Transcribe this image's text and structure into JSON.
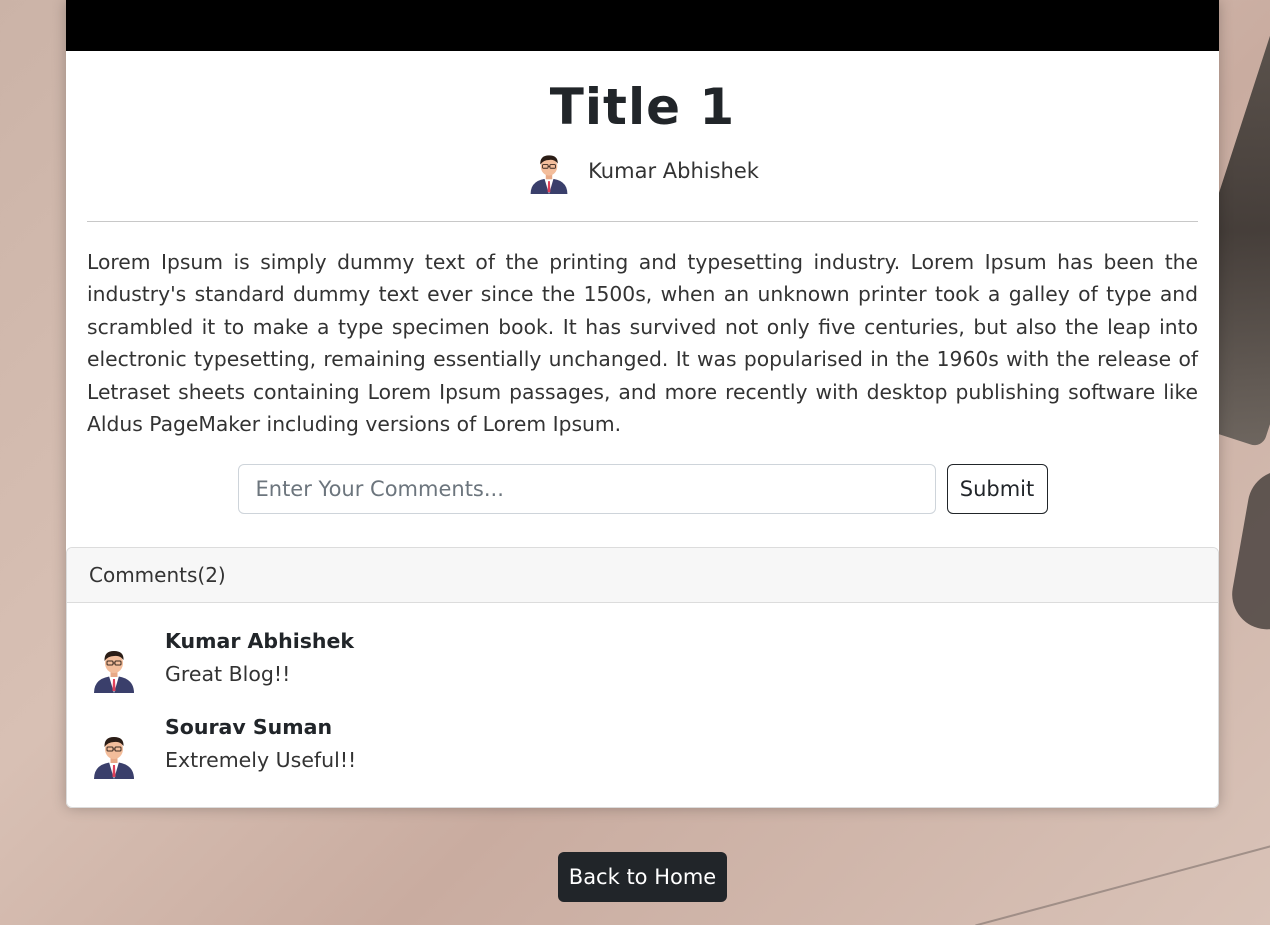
{
  "post": {
    "title": "Title 1",
    "author": "Kumar Abhishek",
    "body": "Lorem Ipsum is simply dummy text of the printing and typesetting industry. Lorem Ipsum has been the industry's standard dummy text ever since the 1500s, when an unknown printer took a galley of type and scrambled it to make a type specimen book. It has survived not only five centuries, but also the leap into electronic typesetting, remaining essentially unchanged. It was popularised in the 1960s with the release of Letraset sheets containing Lorem Ipsum passages, and more recently with desktop publishing software like Aldus PageMaker including versions of Lorem Ipsum."
  },
  "comment_form": {
    "placeholder": "Enter Your Comments...",
    "value": "",
    "submit_label": "Submit"
  },
  "comments": {
    "header": "Comments(2)",
    "items": [
      {
        "author": "Kumar Abhishek",
        "text": "Great Blog!!"
      },
      {
        "author": "Sourav Suman",
        "text": "Extremely Useful!!"
      }
    ]
  },
  "footer": {
    "home_label": "Back to Home"
  },
  "colors": {
    "topbar": "#000000",
    "dark_button": "#212529",
    "card_bg": "#ffffff",
    "comments_header_bg": "#f7f7f7"
  },
  "icons": {
    "author_avatar": "user-avatar-icon",
    "comment_avatar": "user-avatar-icon"
  }
}
